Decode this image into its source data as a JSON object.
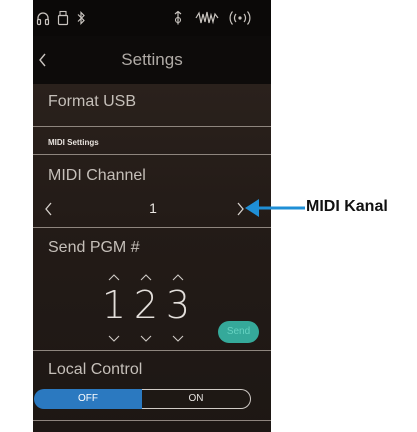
{
  "header": {
    "title": "Settings"
  },
  "status_icons": [
    "headphones-icon",
    "usb-drive-icon",
    "bluetooth-icon",
    "metronome-icon",
    "waveform-icon",
    "wireless-icon"
  ],
  "rows": {
    "format_usb": "Format USB",
    "midi_section": "MIDI Settings",
    "midi_channel": {
      "label": "MIDI Channel",
      "value": "1"
    },
    "send_pgm": {
      "label": "Send PGM #",
      "digits": [
        "1",
        "2",
        "3"
      ],
      "send_label": "Send"
    },
    "local_control": {
      "label": "Local Control",
      "off_label": "OFF",
      "on_label": "ON",
      "selected": "OFF"
    }
  },
  "callout": {
    "label": "MIDI Kanal"
  },
  "colors": {
    "screen_bg": "#14100e",
    "list_bg": "#231b17",
    "accent_blue": "#2b79c0",
    "send_teal": "#35a99a",
    "callout_blue": "#1f8fd6"
  }
}
